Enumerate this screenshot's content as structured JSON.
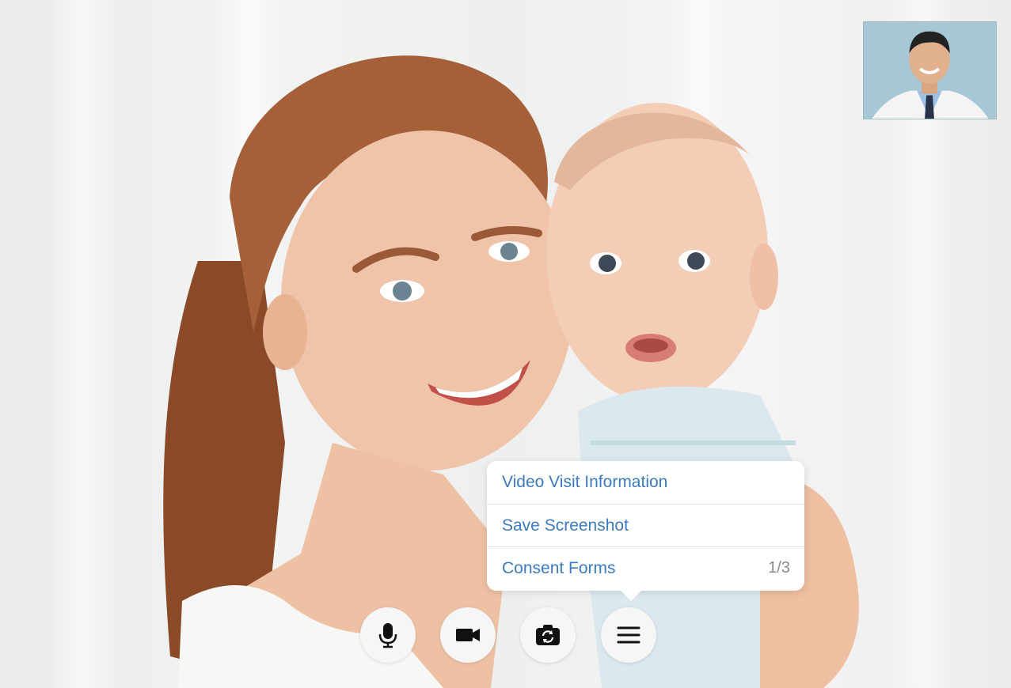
{
  "menu": {
    "items": [
      {
        "label": "Video Visit Information",
        "count": ""
      },
      {
        "label": "Save Screenshot",
        "count": ""
      },
      {
        "label": "Consent Forms",
        "count": "1/3"
      }
    ]
  },
  "controls": {
    "icons": [
      "microphone-icon",
      "video-camera-icon",
      "switch-camera-icon",
      "menu-icon"
    ]
  },
  "colors": {
    "menu_text": "#3b7bbf",
    "count_text": "#8a8a8a",
    "control_bg": "#f6f6f6"
  }
}
